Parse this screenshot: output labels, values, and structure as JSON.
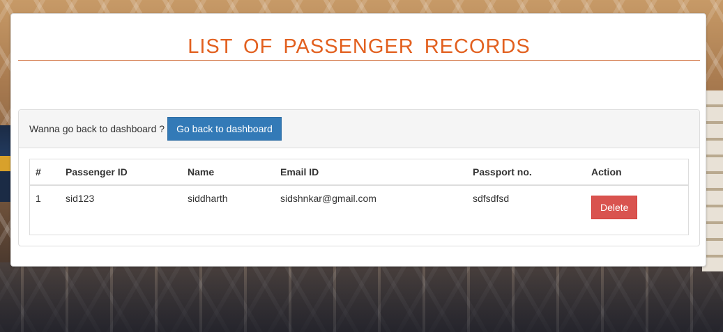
{
  "page": {
    "title": "LIST OF PASSENGER RECORDS"
  },
  "panel": {
    "prompt_text": "Wanna go back to dashboard ?",
    "back_button_label": "Go back to dashboard"
  },
  "table": {
    "headers": [
      "#",
      "Passenger ID",
      "Name",
      "Email ID",
      "Passport no.",
      "Action"
    ],
    "rows": [
      {
        "num": "1",
        "passenger_id": "sid123",
        "name": "siddharth",
        "email": "sidshnkar@gmail.com",
        "passport": "sdfsdfsd",
        "action_label": "Delete"
      }
    ]
  },
  "colors": {
    "title": "#e2601f",
    "primary_button": "#337ab7",
    "danger_button": "#d9534f"
  }
}
